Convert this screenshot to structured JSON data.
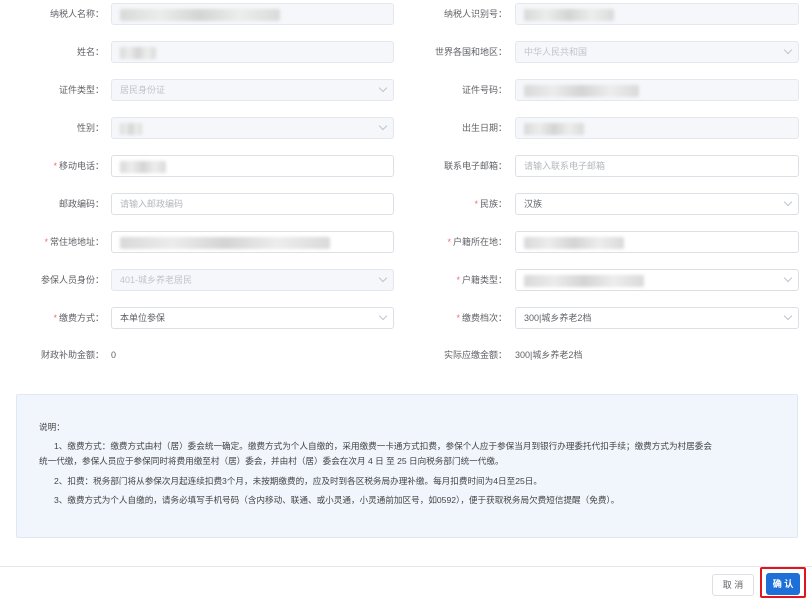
{
  "form": {
    "taxpayer_name": {
      "label": "纳税人名称",
      "value": ""
    },
    "taxpayer_id": {
      "label": "纳税人识别号",
      "value": ""
    },
    "name": {
      "label": "姓名",
      "value": ""
    },
    "country": {
      "label": "世界各国和地区",
      "value": "中华人民共和国"
    },
    "id_type": {
      "label": "证件类型",
      "value": "居民身份证"
    },
    "id_number": {
      "label": "证件号码",
      "value": ""
    },
    "gender": {
      "label": "性别",
      "value": ""
    },
    "birth_date": {
      "label": "出生日期",
      "value": ""
    },
    "mobile": {
      "label": "移动电话",
      "value": ""
    },
    "email": {
      "label": "联系电子邮箱",
      "placeholder": "请输入联系电子邮箱"
    },
    "postcode": {
      "label": "邮政编码",
      "placeholder": "请输入邮政编码"
    },
    "ethnicity": {
      "label": "民族",
      "value": "汉族"
    },
    "address": {
      "label": "常住地地址",
      "value": ""
    },
    "hukou_location": {
      "label": "户籍所在地",
      "value": ""
    },
    "insured_identity": {
      "label": "参保人员身份",
      "value": "401-城乡养老居民"
    },
    "hukou_type": {
      "label": "户籍类型",
      "value": ""
    },
    "payment_method": {
      "label": "缴费方式",
      "value": "本单位参保"
    },
    "payment_level": {
      "label": "缴费档次",
      "value": "300|城乡养老2档"
    },
    "fiscal_subsidy": {
      "label": "财政补助金额：",
      "value": "0"
    },
    "actual_payable": {
      "label": "实际应缴金额：",
      "value": "300|城乡养老2档"
    }
  },
  "notice": {
    "title": "说明：",
    "line1a": "1、缴费方式：缴费方式由村（居）委会统一确定。缴费方式为个人自缴的，采用缴费一卡通方式扣费，参保个人应于参保当月到银行办理委托代扣手续；缴费方式为村居委会",
    "line1b": "统一代缴，参保人员应于参保同时将费用缴至村（居）委会，并由村（居）委会在次月 4 日 至 25 日向税务部门统一代缴。",
    "line2": "2、扣费：税务部门将从参保次月起连续扣费3个月，未按期缴费的，应及时到各区税务局办理补缴。每月扣费时间为4日至25日。",
    "line3": "3、缴费方式为个人自缴的，请务必填写手机号码（含内移动、联通、或小灵通，小灵通前加区号，如0592），便于获取税务局欠费短信提醒（免费）。"
  },
  "buttons": {
    "cancel": "取 消",
    "confirm": "确 认"
  }
}
